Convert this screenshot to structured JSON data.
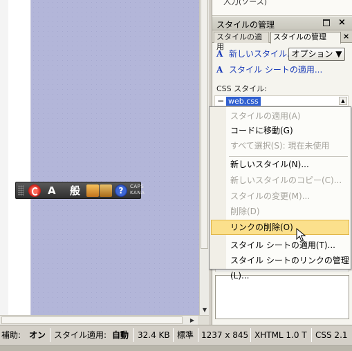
{
  "panel": {
    "prev_item": "入力(ソース)",
    "title": "スタイルの管理",
    "tabs": [
      "スタイルの適用",
      "スタイルの管理"
    ],
    "new_style_link": "新しいスタイル...",
    "options_button": "オプション ▼",
    "attach_stylesheet_link": "スタイル シートの適用...",
    "css_styles_label": "CSS スタイル:",
    "stylesheet": "web.css"
  },
  "context_menu": {
    "items": [
      {
        "label": "スタイルの適用(A)",
        "enabled": false
      },
      {
        "label": "コードに移動(G)",
        "enabled": true
      },
      {
        "label": "すべて選択(S): 現在未使用",
        "enabled": false
      },
      {
        "label": "新しいスタイル(N)...",
        "enabled": true
      },
      {
        "label": "新しいスタイルのコピー(C)...",
        "enabled": false
      },
      {
        "label": "スタイルの変更(M)...",
        "enabled": false
      },
      {
        "label": "削除(D)",
        "enabled": false
      },
      {
        "label": "リンクの削除(O)",
        "enabled": true,
        "highlighted": true
      },
      {
        "label": "スタイル シートの適用(T)...",
        "enabled": true
      },
      {
        "label": "スタイル シートのリンクの管理(L)...",
        "enabled": true
      }
    ]
  },
  "ime_bar": {
    "mode_char": "A",
    "dict_char": "般",
    "caps": "CAPS",
    "kana": "KANA",
    "help": "?"
  },
  "status_bar": {
    "assist_label": "補助:",
    "assist_value": "オン",
    "style_apply_label": "スタイル適用:",
    "style_apply_value": "自動",
    "file_size": "32.4 KB",
    "mode": "標準",
    "resolution": "1237 x 845",
    "doctype": "XHTML 1.0 T",
    "css_version": "CSS 2.1"
  },
  "colors": {
    "canvas_page": "#b3b6d9",
    "highlight": "#fbe08c",
    "link": "#1a3bb8",
    "selection": "#2f5fd0"
  }
}
